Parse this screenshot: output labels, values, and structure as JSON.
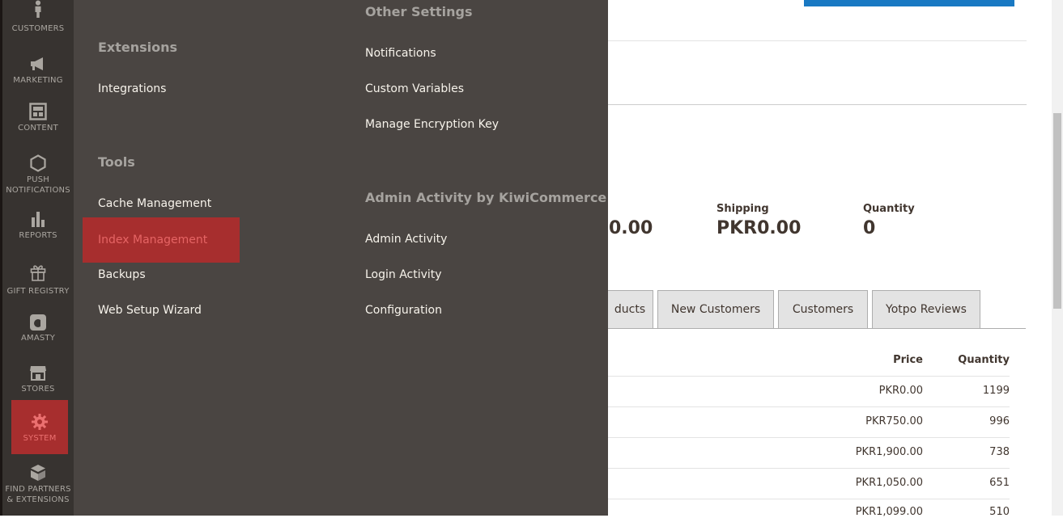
{
  "sidebar": {
    "items": [
      {
        "id": "customers",
        "label": "CUSTOMERS",
        "icon": "person-icon"
      },
      {
        "id": "marketing",
        "label": "MARKETING",
        "icon": "megaphone-icon"
      },
      {
        "id": "content",
        "label": "CONTENT",
        "icon": "layout-icon"
      },
      {
        "id": "push",
        "label_line1": "PUSH",
        "label_line2": "NOTIFICATIONS",
        "icon": "hexagon-icon"
      },
      {
        "id": "reports",
        "label": "REPORTS",
        "icon": "bar-chart-icon"
      },
      {
        "id": "gift",
        "label": "GIFT REGISTRY",
        "icon": "gift-icon"
      },
      {
        "id": "amasty",
        "label": "AMASTY",
        "icon": "amasty-icon"
      },
      {
        "id": "stores",
        "label": "STORES",
        "icon": "store-icon"
      },
      {
        "id": "system",
        "label": "SYSTEM",
        "icon": "gear-icon",
        "active": true
      },
      {
        "id": "partners",
        "label_line1": "FIND PARTNERS",
        "label_line2": "& EXTENSIONS",
        "icon": "blocks-icon"
      }
    ]
  },
  "flyout": {
    "extensions": {
      "heading": "Extensions",
      "links": [
        "Integrations"
      ]
    },
    "tools": {
      "heading": "Tools",
      "links": [
        "Cache Management",
        "Index Management",
        "Backups",
        "Web Setup Wizard"
      ],
      "active": "Index Management"
    },
    "other_settings": {
      "heading": "Other Settings",
      "links": [
        "Notifications",
        "Custom Variables",
        "Manage Encryption Key"
      ]
    },
    "admin_activity": {
      "heading": "Admin Activity by KiwiCommerce",
      "links": [
        "Admin Activity",
        "Login Activity",
        "Configuration"
      ]
    }
  },
  "dashboard": {
    "stats": [
      {
        "label": "",
        "value": "0.00"
      },
      {
        "label": "Shipping",
        "value": "PKR0.00"
      },
      {
        "label": "Quantity",
        "value": "0"
      }
    ],
    "tabs": [
      "ducts",
      "New Customers",
      "Customers",
      "Yotpo Reviews"
    ],
    "table": {
      "headers": [
        "Price",
        "Quantity"
      ],
      "rows": [
        {
          "price": "PKR0.00",
          "qty": "1199"
        },
        {
          "price": "PKR750.00",
          "qty": "996"
        },
        {
          "price": "PKR1,900.00",
          "qty": "738"
        },
        {
          "price": "PKR1,050.00",
          "qty": "651"
        },
        {
          "price": "PKR1,099.00",
          "qty": "510"
        }
      ]
    }
  },
  "colors": {
    "sidebar": "#373330",
    "flyout": "#4a4542",
    "active": "#a72e2e",
    "accent": "#1979c3"
  }
}
